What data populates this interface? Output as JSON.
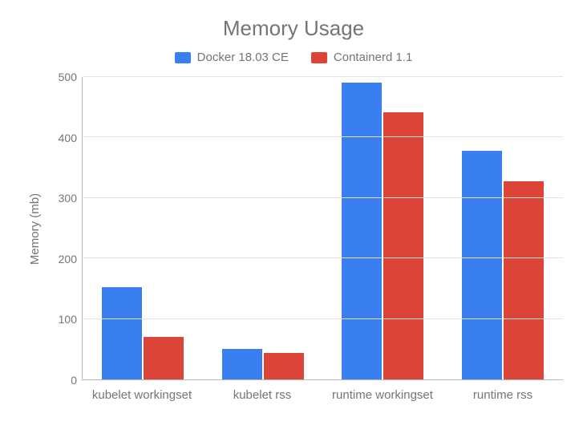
{
  "chart_data": {
    "type": "bar",
    "title": "Memory Usage",
    "ylabel": "Memory (mb)",
    "xlabel": "",
    "ylim": [
      0,
      500
    ],
    "ytick_step": 100,
    "categories": [
      "kubelet workingset",
      "kubelet rss",
      "runtime workingset",
      "runtime rss"
    ],
    "series": [
      {
        "name": "Docker 18.03 CE",
        "color": "#3a7ff2",
        "values": [
          152,
          50,
          491,
          378
        ]
      },
      {
        "name": "Containerd 1.1",
        "color": "#db4437",
        "values": [
          70,
          44,
          442,
          328
        ]
      }
    ]
  }
}
